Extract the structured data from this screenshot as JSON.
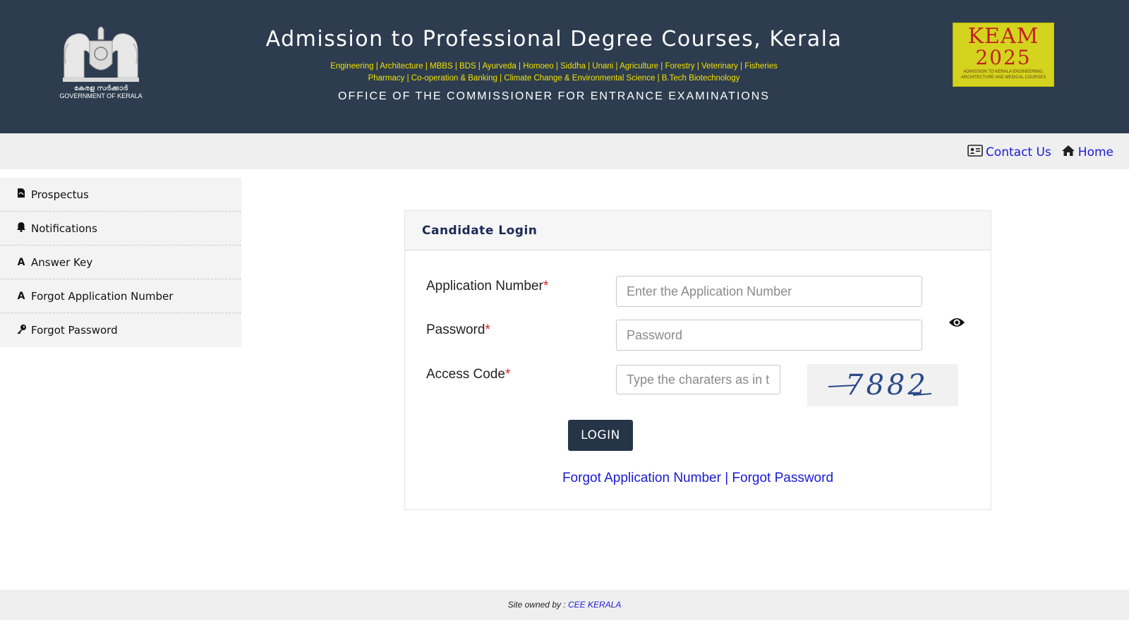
{
  "header": {
    "title": "Admission to Professional Degree Courses, Kerala",
    "courses_line1": [
      "Engineering",
      "Architecture",
      "MBBS",
      "BDS",
      "Ayurveda",
      "Homoeo",
      "Siddha",
      "Unani",
      "Agriculture",
      "Forestry",
      "Veterinary",
      "Fisheries"
    ],
    "courses_line2": [
      "Pharmacy",
      "Co-operation & Banking",
      "Climate Change & Environmental Science",
      "B.Tech Biotechnology"
    ],
    "office": "OFFICE OF THE COMMISSIONER FOR ENTRANCE EXAMINATIONS",
    "emblem_text_malayalam": "കേരള സർക്കാർ",
    "emblem_text_english": "GOVERNMENT OF KERALA",
    "keam_logo": {
      "word": "KEAM",
      "year": "2025",
      "subtitle": "ADMISSION TO KERALA ENGINEERING, ARCHITECTURE AND MEDICAL COURSES"
    }
  },
  "navbar": {
    "contact_label": "Contact Us",
    "contact_icon": "contact-card-icon",
    "home_label": "Home",
    "home_icon": "home-icon"
  },
  "sidebar": {
    "items": [
      {
        "label": "Prospectus",
        "icon": "pdf-file-icon"
      },
      {
        "label": "Notifications",
        "icon": "bell-icon"
      },
      {
        "label": "Answer Key",
        "icon": "letter-a-icon"
      },
      {
        "label": "Forgot Application Number",
        "icon": "letter-a-icon"
      },
      {
        "label": "Forgot Password",
        "icon": "key-icon"
      }
    ]
  },
  "login": {
    "title": "Candidate Login",
    "app_number_label": "Application Number",
    "app_number_placeholder": "Enter the Application Number",
    "password_label": "Password",
    "password_placeholder": "Password",
    "access_code_label": "Access Code",
    "access_code_placeholder": "Type the charaters as in th",
    "required_mark": "*",
    "captcha_text": "7882",
    "login_button": "LOGIN",
    "forgot_app_link": "Forgot Application Number",
    "link_separator": "|",
    "forgot_password_link": "Forgot Password"
  },
  "footer": {
    "prefix": "Site owned by : ",
    "owner_link": "CEE KERALA"
  },
  "colors": {
    "header_bg": "#2d3c4f",
    "course_yellow": "#f2e200",
    "link_blue": "#1a1ad6",
    "button_bg": "#253447",
    "required_red": "#e02020"
  }
}
